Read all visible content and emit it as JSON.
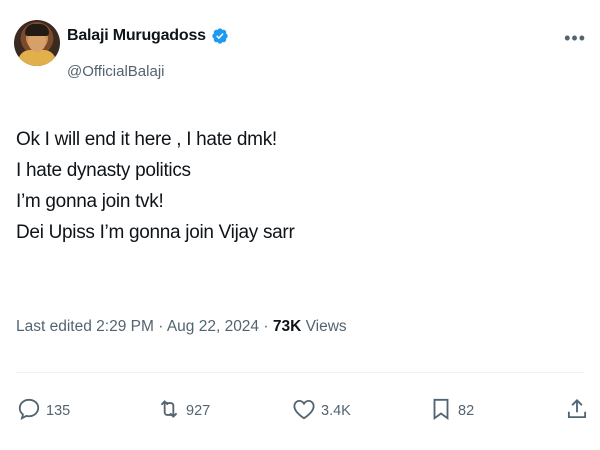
{
  "author": {
    "display_name": "Balaji Murugadoss",
    "handle": "@OfficialBalaji",
    "verified_color": "#1d9bf0"
  },
  "tweet": {
    "lines": [
      "Ok I will end it here , I hate dmk!",
      "I hate dynasty politics",
      "I’m gonna join tvk!",
      "Dei Upiss I’m gonna join Vijay sarr"
    ]
  },
  "meta": {
    "edited_prefix": "Last edited",
    "time": "2:29 PM",
    "separator": "·",
    "date": "Aug 22, 2024",
    "views_count": "73K",
    "views_label": "Views"
  },
  "actions": {
    "reply_count": "135",
    "retweet_count": "927",
    "like_count": "3.4K",
    "bookmark_count": "82"
  },
  "icons": {
    "more": "more-icon",
    "reply": "reply-icon",
    "retweet": "retweet-icon",
    "like": "heart-icon",
    "bookmark": "bookmark-icon",
    "share": "share-icon"
  }
}
